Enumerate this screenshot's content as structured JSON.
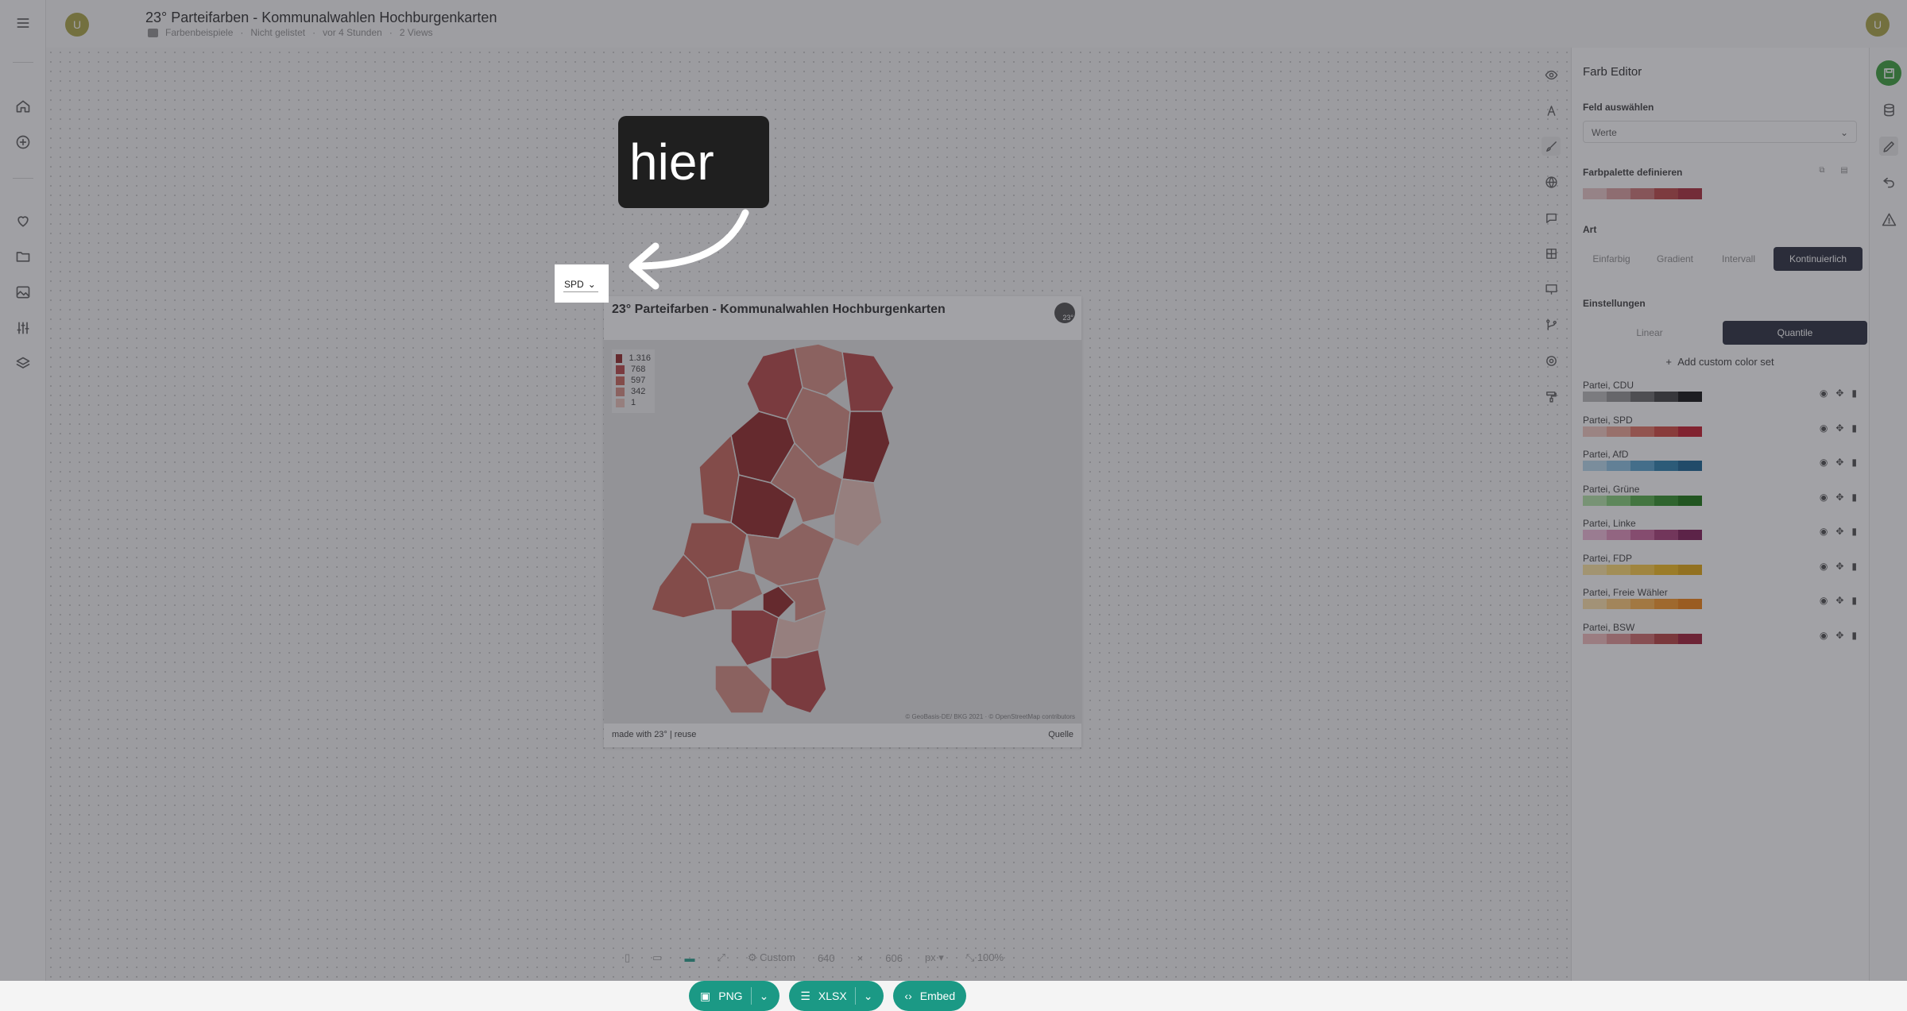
{
  "header": {
    "title": "23° Parteifarben - Kommunalwahlen Hochburgenkarten",
    "folder": "Farbenbeispiele",
    "status": "Nicht gelistet",
    "updated": "vor 4 Stunden",
    "views": "2 Views",
    "avatar_letter": "U"
  },
  "callout": {
    "text": "hier"
  },
  "chart": {
    "title": "23° Parteifarben - Kommunalwahlen Hochburgenkarten",
    "logo": "23°",
    "party_select": "SPD",
    "legend": [
      {
        "label": "1.316",
        "color": "#8b1a1a"
      },
      {
        "label": "768",
        "color": "#b23a3a"
      },
      {
        "label": "597",
        "color": "#c45a50"
      },
      {
        "label": "342",
        "color": "#d4857a"
      },
      {
        "label": "1",
        "color": "#e8bcb2"
      }
    ],
    "attribution": "© GeoBasis-DE/ BKG 2021 · © OpenStreetMap contributors",
    "footer_left": "made with 23° | reuse",
    "footer_right": "Quelle"
  },
  "size_bar": {
    "preset": "Custom",
    "width": "640",
    "times": "×",
    "height": "606",
    "unit": "px",
    "zoom": "100%"
  },
  "export": {
    "png": "PNG",
    "xlsx": "XLSX",
    "embed": "Embed"
  },
  "panel": {
    "title": "Farb Editor",
    "field_label": "Feld auswählen",
    "field_value": "Werte",
    "palette_label": "Farbpalette definieren",
    "palette": [
      "#e9c3c3",
      "#d99a9a",
      "#c96b6b",
      "#b83a3a",
      "#a51d2d"
    ],
    "art_label": "Art",
    "art_options": [
      "Einfarbig",
      "Gradient",
      "Intervall",
      "Kontinuierlich"
    ],
    "art_selected": "Kontinuierlich",
    "settings_label": "Einstellungen",
    "settings_options": [
      "Linear",
      "Quantile"
    ],
    "settings_selected": "Quantile",
    "add_custom": "Add custom color set",
    "color_sets": [
      {
        "name": "Partei, CDU",
        "colors": [
          "#b5b5b5",
          "#8c8c8c",
          "#5e5e5e",
          "#333333",
          "#000000"
        ]
      },
      {
        "name": "Partei, SPD",
        "colors": [
          "#f2c6bc",
          "#eba08f",
          "#e06a58",
          "#d03c32",
          "#c00d1e"
        ]
      },
      {
        "name": "Partei, AfD",
        "colors": [
          "#b3d7ec",
          "#84bfe0",
          "#4b9cc9",
          "#1e78a8",
          "#09588a"
        ]
      },
      {
        "name": "Partei, Grüne",
        "colors": [
          "#aee3a2",
          "#7ecb6f",
          "#4aaa3c",
          "#23881a",
          "#0a6b00"
        ]
      },
      {
        "name": "Partei, Linke",
        "colors": [
          "#f0b6d6",
          "#e08ab8",
          "#c75a96",
          "#a4306f",
          "#7a0d4c"
        ]
      },
      {
        "name": "Partei, FDP",
        "colors": [
          "#ffe59a",
          "#ffd866",
          "#fcc83a",
          "#f2b70f",
          "#e0a100"
        ]
      },
      {
        "name": "Partei, Freie Wähler",
        "colors": [
          "#ffe0a6",
          "#ffc870",
          "#ffae40",
          "#fa931a",
          "#f07a00"
        ]
      },
      {
        "name": "Partei, BSW",
        "colors": [
          "#f2b9b9",
          "#e08f8f",
          "#cc6060",
          "#b33434",
          "#9a0e2a"
        ]
      }
    ]
  }
}
